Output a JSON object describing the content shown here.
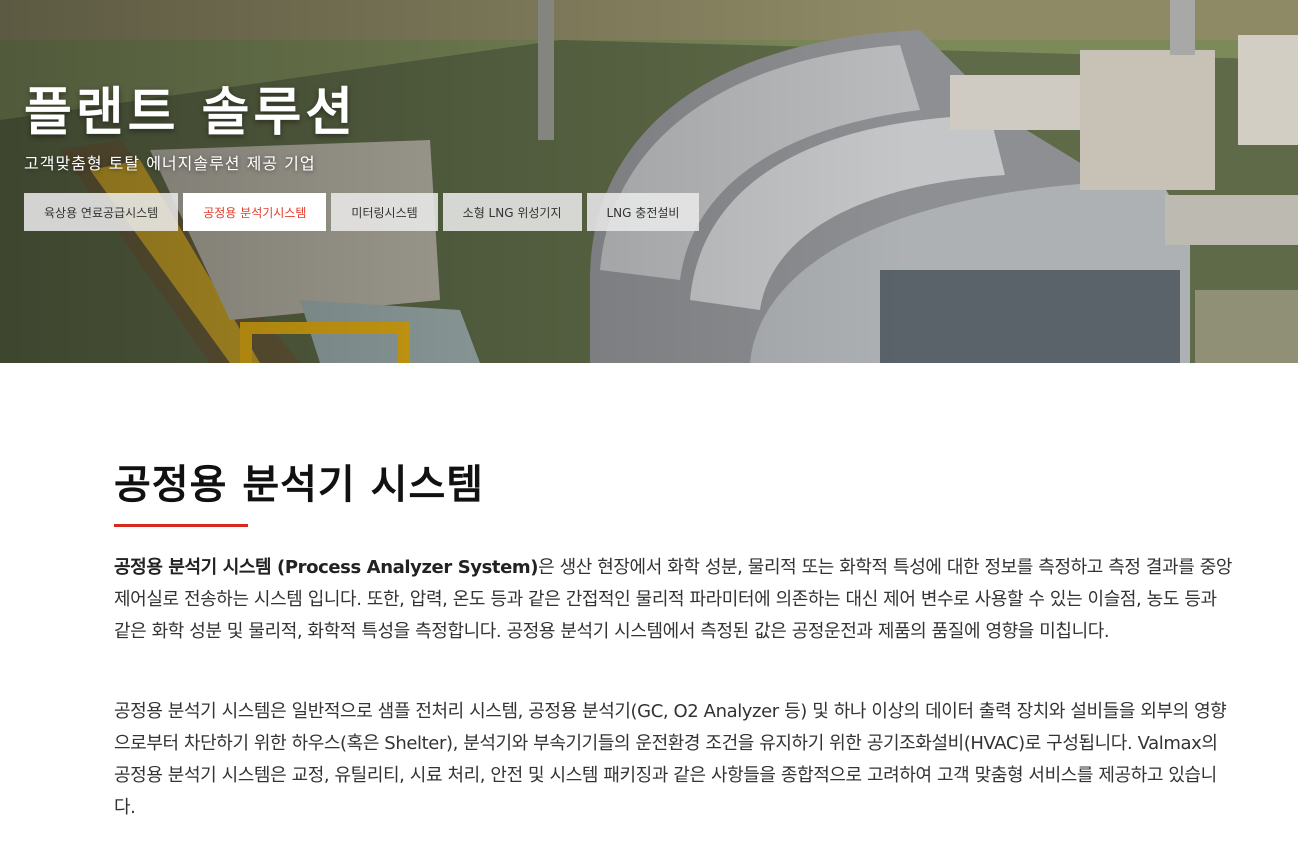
{
  "hero": {
    "title": "플랜트 솔루션",
    "subtitle": "고객맞춤형 토탈 에너지솔루션 제공 기업"
  },
  "tabs": [
    {
      "label": "육상용 연료공급시스템",
      "active": false
    },
    {
      "label": "공정용 분석기시스템",
      "active": true
    },
    {
      "label": "미터링시스템",
      "active": false
    },
    {
      "label": "소형 LNG 위성기지",
      "active": false
    },
    {
      "label": "LNG 충전설비",
      "active": false
    }
  ],
  "section": {
    "title": "공정용 분석기 시스템",
    "para1_bold": "공정용 분석기 시스템 (Process Analyzer System)",
    "para1_rest": "은 생산 현장에서 화학 성분, 물리적 또는 화학적 특성에 대한 정보를 측정하고 측정 결과를 중앙 제어실로 전송하는 시스템 입니다. 또한, 압력, 온도 등과 같은 간접적인 물리적 파라미터에 의존하는 대신 제어 변수로 사용할 수 있는 이슬점, 농도 등과 같은 화학 성분 및 물리적, 화학적 특성을 측정합니다. 공정용 분석기 시스템에서 측정된 값은 공정운전과 제품의 품질에 영향을 미칩니다.",
    "para2": "공정용 분석기 시스템은 일반적으로 샘플 전처리 시스템, 공정용 분석기(GC, O2 Analyzer 등) 및 하나 이상의 데이터 출력 장치와 설비들을 외부의 영향으로부터 차단하기 위한 하우스(혹은 Shelter), 분석기와 부속기기들의 운전환경 조건을 유지하기 위한 공기조화설비(HVAC)로 구성됩니다. Valmax의 공정용 분석기 시스템은 교정, 유틸리티, 시료 처리, 안전 및 시스템 패키징과 같은 사항들을 종합적으로 고려하여 고객 맞춤형 서비스를 제공하고 있습니다."
  },
  "colors": {
    "accent": "#d9281e",
    "active_tab_text": "#e53a2a"
  }
}
